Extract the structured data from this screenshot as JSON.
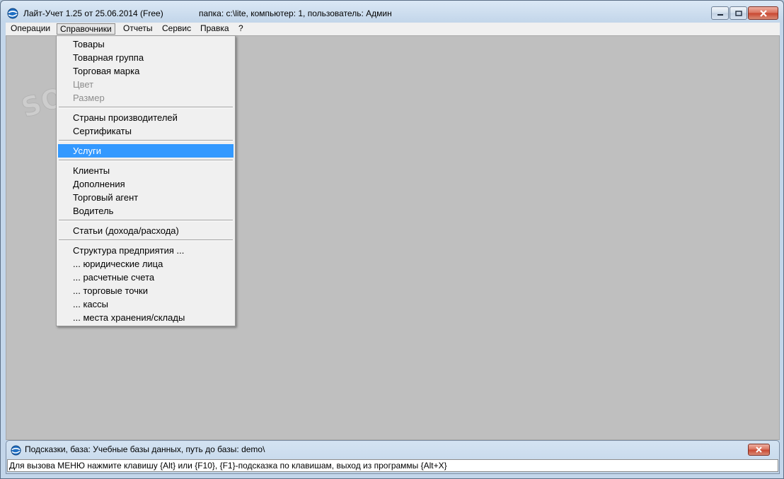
{
  "window": {
    "title": "Лайт-Учет 1.25 от 25.06.2014 (Free)",
    "info": "папка: c:\\lite, компьютер: 1, пользователь: Админ",
    "icon": "globe-icon"
  },
  "menubar": {
    "items": [
      {
        "label": "Операции"
      },
      {
        "label": "Справочники",
        "active": true
      },
      {
        "label": "Отчеты"
      },
      {
        "label": "Сервис"
      },
      {
        "label": "Правка"
      },
      {
        "label": "?"
      }
    ]
  },
  "dropdown": {
    "groups": [
      [
        {
          "label": "Товары"
        },
        {
          "label": "Товарная группа"
        },
        {
          "label": "Торговая марка"
        },
        {
          "label": "Цвет",
          "disabled": true
        },
        {
          "label": "Размер",
          "disabled": true
        }
      ],
      [
        {
          "label": "Страны производителей"
        },
        {
          "label": "Сертификаты"
        }
      ],
      [
        {
          "label": "Услуги",
          "selected": true
        }
      ],
      [
        {
          "label": "Клиенты"
        },
        {
          "label": "Дополнения"
        },
        {
          "label": "Торговый агент"
        },
        {
          "label": "Водитель"
        }
      ],
      [
        {
          "label": "Статьи (дохода/расхода)"
        }
      ],
      [
        {
          "label": "Структура предприятия ..."
        },
        {
          "label": "... юридические лица"
        },
        {
          "label": "... расчетные счета"
        },
        {
          "label": "... торговые точки"
        },
        {
          "label": "... кассы"
        },
        {
          "label": "... места хранения/склады"
        }
      ]
    ]
  },
  "hint_panel": {
    "title": "Подсказки, база: Учебные базы данных, путь до базы: demo\\",
    "status": "Для вызова МЕНЮ нажмите клавишу {Alt} или {F10}, {F1}-подсказка по клавишам, выход из программы {Alt+X}"
  },
  "watermark": "SOFTPORTAL",
  "colors": {
    "selection": "#3399ff",
    "mdi_background": "#bfbfbf",
    "menu_background": "#f0f0f0",
    "close_button": "#c9452e"
  }
}
